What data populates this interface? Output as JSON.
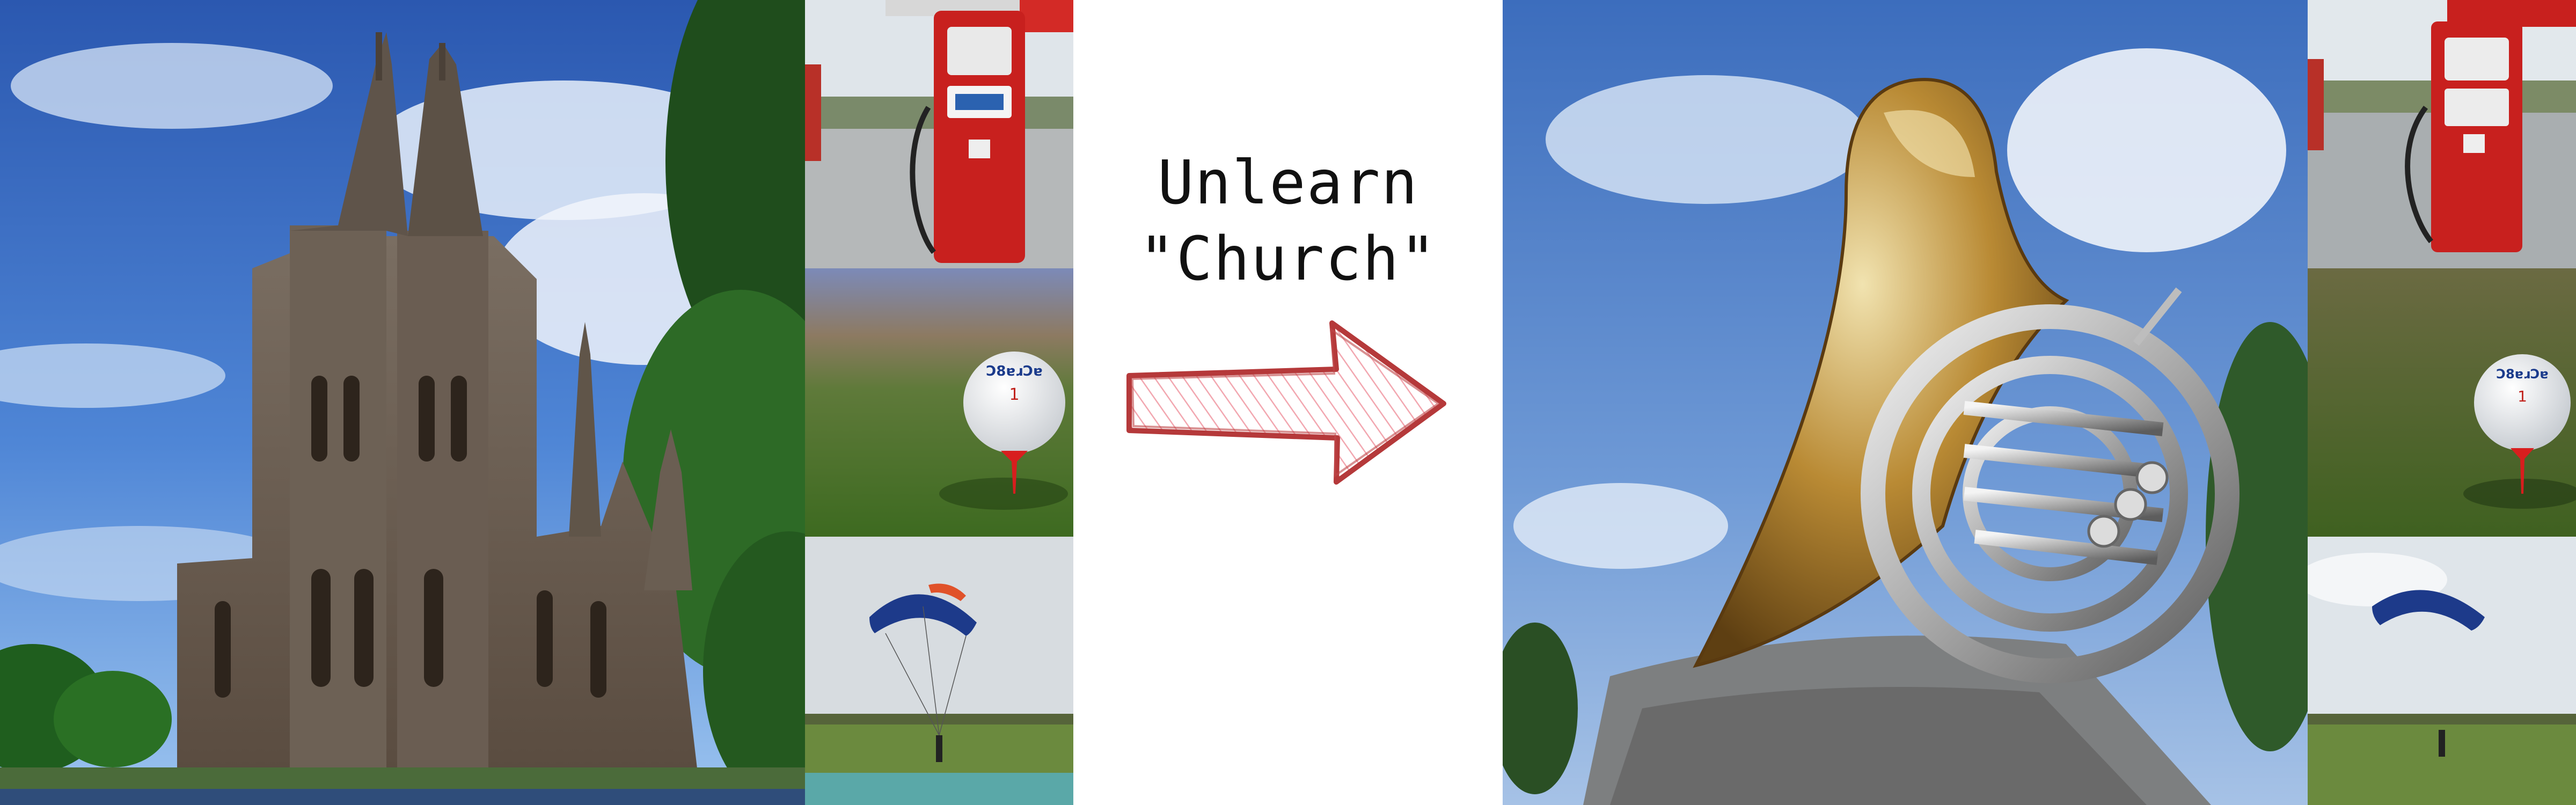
{
  "caption": {
    "line1": "Unlearn",
    "line2": "\"Church\""
  },
  "colors": {
    "sky": "#3d6fc0",
    "pump_red": "#c8201e",
    "grass": "#4f7a2e",
    "arrow_outline": "#b5393a",
    "arrow_fill": "#f4b9bf",
    "horn_brass": "#b98a34"
  },
  "panels": {
    "left_main": "church-photo",
    "right_main": "french-horn-photo",
    "left_thumbs": [
      "gas-pump-photo",
      "golf-ball-photo",
      "parachute-photo"
    ],
    "right_thumbs": [
      "gas-pump-photo",
      "golf-ball-photo",
      "parachute-photo"
    ]
  },
  "golf_ball_print": "Ɔ8ɐɹƆɐ"
}
